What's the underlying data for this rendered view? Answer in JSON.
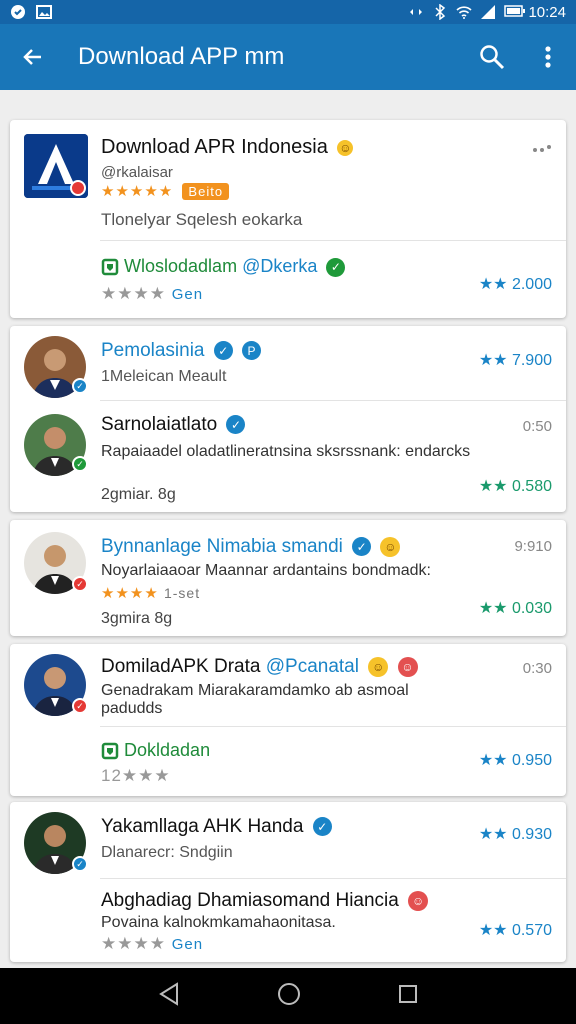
{
  "status_bar": {
    "time": "10:24"
  },
  "app_bar": {
    "title": "Download APP mm"
  },
  "colors": {
    "primary": "#1976b8",
    "primary_dark": "#1565a8",
    "star_blue": "#1a84c7",
    "star_green": "#1a9a6c",
    "orange": "#f2921e"
  },
  "featured": {
    "title": "Download APR Indonesia",
    "developer": "@rkalaisar",
    "stars_text": "★★★★★",
    "tag": "Beito",
    "tagline": "Tlonelyar Sqelesh eokarka",
    "extra_title": "Wloslodadlam",
    "extra_mention": "@Dkerka",
    "extra_stars": "★★★★",
    "extra_stars_note": "Gen",
    "rating": "2.000"
  },
  "list": [
    {
      "name": "Pemolasinia",
      "subtitle": "1Meleican Meault",
      "rating": "7.900"
    },
    {
      "name": "Sarnolaiatlato",
      "time": "0:50",
      "description": "Rapaiaadel oladatlineratnsina sksrssnank: endarcks",
      "meta": "2gmiar. 8g",
      "rating": "0.580"
    },
    {
      "name": "Bynnanlage Nimabia smandi",
      "time": "9:910",
      "description": "Noyarlaiaaoar Maannar ardantains bondmadk:",
      "stars_text": "★★★★",
      "stars_note": "1-set",
      "meta": "3gmira 8g",
      "rating": "0.030"
    },
    {
      "name": "DomiladAPK Drata",
      "mention": "@Pcanatal",
      "time": "0:30",
      "description": "Genadrakam Miarakaramdamko ab asmoal padudds",
      "sub_title": "Dokldadan",
      "stars_text": "12★★★",
      "rating": "0.950"
    },
    {
      "name": "Yakamllaga AHK Handa",
      "subtitle": "Dlanarecr: Sndgiin",
      "rating": "0.930",
      "sub_title": "Abghadiag Dhamiasomand Hiancia",
      "description": "Povaina kalnokmkamahaonitasa.",
      "stars_text": "★★★★",
      "stars_note": "Gen",
      "rating2": "0.570"
    }
  ]
}
